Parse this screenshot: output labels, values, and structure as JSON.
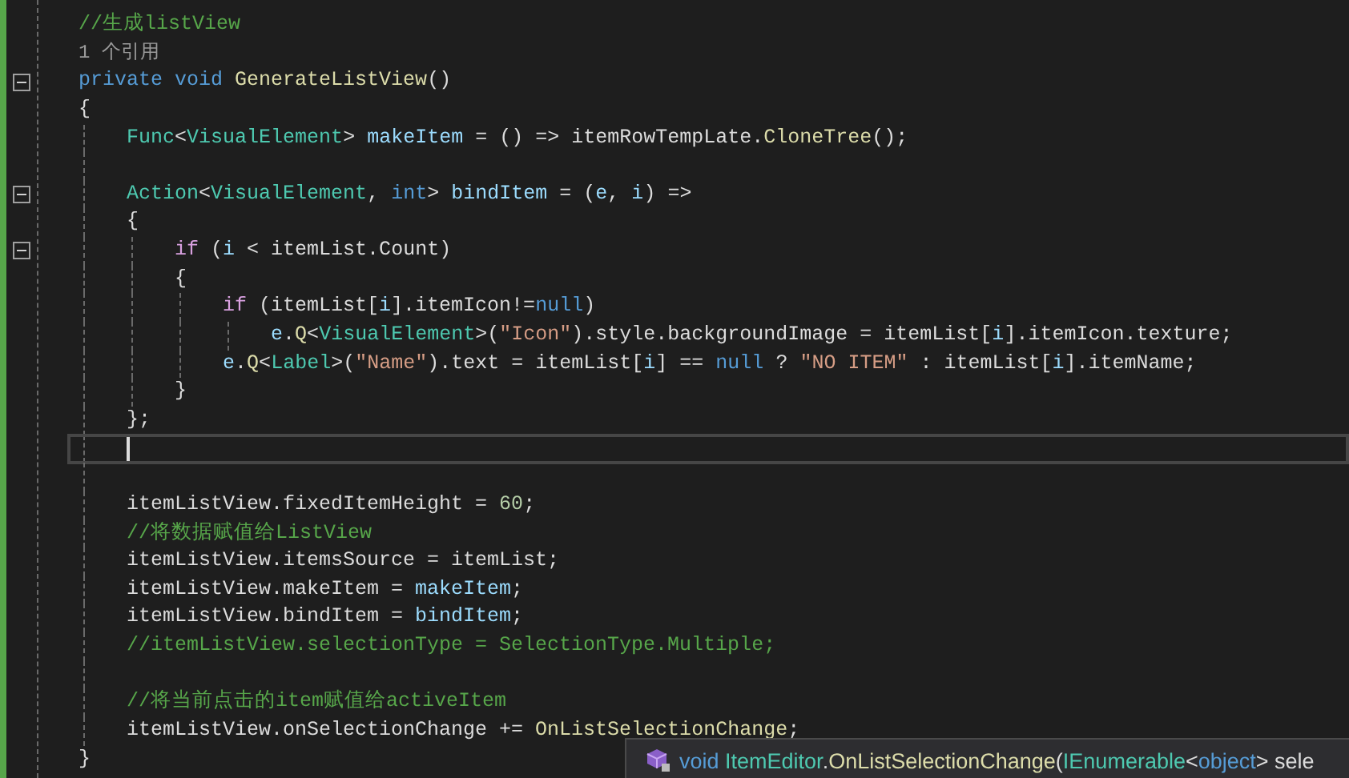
{
  "editor": {
    "lines": [
      {
        "kind": "code",
        "fold": false,
        "current": false,
        "tokens": [
          {
            "text": "//生成listView",
            "kind": "comment"
          }
        ]
      },
      {
        "kind": "codelens",
        "fold": false,
        "current": false,
        "tokens": [
          {
            "text": "1 个引用",
            "kind": "lens"
          }
        ]
      },
      {
        "kind": "code",
        "fold": true,
        "current": false,
        "tokens": [
          {
            "text": "private void ",
            "kind": "keyword"
          },
          {
            "text": "GenerateListView",
            "kind": "method"
          },
          {
            "text": "()",
            "kind": "plain"
          }
        ]
      },
      {
        "kind": "code",
        "fold": false,
        "current": false,
        "tokens": [
          {
            "text": "{",
            "kind": "plain"
          }
        ],
        "children": [
          {
            "kind": "code",
            "fold": false,
            "current": false,
            "tokens": [
              {
                "text": "Func",
                "kind": "type"
              },
              {
                "text": "<",
                "kind": "plain"
              },
              {
                "text": "VisualElement",
                "kind": "type"
              },
              {
                "text": "> ",
                "kind": "plain"
              },
              {
                "text": "makeItem",
                "kind": "local"
              },
              {
                "text": " = () => itemRowTempLate.",
                "kind": "plain"
              },
              {
                "text": "CloneTree",
                "kind": "method"
              },
              {
                "text": "();",
                "kind": "plain"
              }
            ]
          },
          {
            "kind": "blank",
            "fold": false,
            "current": false
          },
          {
            "kind": "code",
            "fold": true,
            "current": false,
            "tokens": [
              {
                "text": "Action",
                "kind": "type"
              },
              {
                "text": "<",
                "kind": "plain"
              },
              {
                "text": "VisualElement",
                "kind": "type"
              },
              {
                "text": ", ",
                "kind": "plain"
              },
              {
                "text": "int",
                "kind": "keyword"
              },
              {
                "text": "> ",
                "kind": "plain"
              },
              {
                "text": "bindItem",
                "kind": "local"
              },
              {
                "text": " = (",
                "kind": "plain"
              },
              {
                "text": "e",
                "kind": "local"
              },
              {
                "text": ", ",
                "kind": "plain"
              },
              {
                "text": "i",
                "kind": "local"
              },
              {
                "text": ") =>",
                "kind": "plain"
              }
            ]
          },
          {
            "kind": "code",
            "fold": false,
            "current": false,
            "tokens": [
              {
                "text": "{",
                "kind": "plain"
              }
            ],
            "children": [
              {
                "kind": "code",
                "fold": true,
                "current": false,
                "tokens": [
                  {
                    "text": "if",
                    "kind": "control"
                  },
                  {
                    "text": " (",
                    "kind": "plain"
                  },
                  {
                    "text": "i",
                    "kind": "local"
                  },
                  {
                    "text": " < itemList.Count)",
                    "kind": "plain"
                  }
                ]
              },
              {
                "kind": "code",
                "fold": false,
                "current": false,
                "tokens": [
                  {
                    "text": "{",
                    "kind": "plain"
                  }
                ],
                "children": [
                  {
                    "kind": "code",
                    "fold": false,
                    "current": false,
                    "tokens": [
                      {
                        "text": "if",
                        "kind": "control"
                      },
                      {
                        "text": " (itemList[",
                        "kind": "plain"
                      },
                      {
                        "text": "i",
                        "kind": "local"
                      },
                      {
                        "text": "].itemIcon!=",
                        "kind": "plain"
                      },
                      {
                        "text": "null",
                        "kind": "keyword"
                      },
                      {
                        "text": ")",
                        "kind": "plain"
                      }
                    ],
                    "children": [
                      {
                        "kind": "code",
                        "fold": false,
                        "current": false,
                        "tokens": [
                          {
                            "text": "e",
                            "kind": "local"
                          },
                          {
                            "text": ".",
                            "kind": "plain"
                          },
                          {
                            "text": "Q",
                            "kind": "method"
                          },
                          {
                            "text": "<",
                            "kind": "plain"
                          },
                          {
                            "text": "VisualElement",
                            "kind": "type"
                          },
                          {
                            "text": ">(",
                            "kind": "plain"
                          },
                          {
                            "text": "\"Icon\"",
                            "kind": "string"
                          },
                          {
                            "text": ").style.backgroundImage = itemList[",
                            "kind": "plain"
                          },
                          {
                            "text": "i",
                            "kind": "local"
                          },
                          {
                            "text": "].itemIcon.texture;",
                            "kind": "plain"
                          }
                        ]
                      }
                    ]
                  },
                  {
                    "kind": "code",
                    "fold": false,
                    "current": false,
                    "tokens": [
                      {
                        "text": "e",
                        "kind": "local"
                      },
                      {
                        "text": ".",
                        "kind": "plain"
                      },
                      {
                        "text": "Q",
                        "kind": "method"
                      },
                      {
                        "text": "<",
                        "kind": "plain"
                      },
                      {
                        "text": "Label",
                        "kind": "type"
                      },
                      {
                        "text": ">(",
                        "kind": "plain"
                      },
                      {
                        "text": "\"Name\"",
                        "kind": "string"
                      },
                      {
                        "text": ").text = itemList[",
                        "kind": "plain"
                      },
                      {
                        "text": "i",
                        "kind": "local"
                      },
                      {
                        "text": "] == ",
                        "kind": "plain"
                      },
                      {
                        "text": "null",
                        "kind": "keyword"
                      },
                      {
                        "text": " ? ",
                        "kind": "plain"
                      },
                      {
                        "text": "\"NO ITEM\"",
                        "kind": "string"
                      },
                      {
                        "text": " : itemList[",
                        "kind": "plain"
                      },
                      {
                        "text": "i",
                        "kind": "local"
                      },
                      {
                        "text": "].itemName;",
                        "kind": "plain"
                      }
                    ]
                  }
                ]
              },
              {
                "kind": "code",
                "fold": false,
                "current": false,
                "tokens": [
                  {
                    "text": "}",
                    "kind": "plain"
                  }
                ]
              }
            ]
          },
          {
            "kind": "code",
            "fold": false,
            "current": false,
            "tokens": [
              {
                "text": "};",
                "kind": "plain"
              }
            ]
          },
          {
            "kind": "blank",
            "fold": false,
            "current": true
          },
          {
            "kind": "blank",
            "fold": false,
            "current": false
          },
          {
            "kind": "code",
            "fold": false,
            "current": false,
            "tokens": [
              {
                "text": "itemListView.fixedItemHeight = ",
                "kind": "plain"
              },
              {
                "text": "60",
                "kind": "number"
              },
              {
                "text": ";",
                "kind": "plain"
              }
            ]
          },
          {
            "kind": "code",
            "fold": false,
            "current": false,
            "tokens": [
              {
                "text": "//将数据赋值给ListView",
                "kind": "comment"
              }
            ]
          },
          {
            "kind": "code",
            "fold": false,
            "current": false,
            "tokens": [
              {
                "text": "itemListView.itemsSource = itemList;",
                "kind": "plain"
              }
            ]
          },
          {
            "kind": "code",
            "fold": false,
            "current": false,
            "tokens": [
              {
                "text": "itemListView.makeItem = ",
                "kind": "plain"
              },
              {
                "text": "makeItem",
                "kind": "local"
              },
              {
                "text": ";",
                "kind": "plain"
              }
            ]
          },
          {
            "kind": "code",
            "fold": false,
            "current": false,
            "tokens": [
              {
                "text": "itemListView.bindItem = ",
                "kind": "plain"
              },
              {
                "text": "bindItem",
                "kind": "local"
              },
              {
                "text": ";",
                "kind": "plain"
              }
            ]
          },
          {
            "kind": "code",
            "fold": false,
            "current": false,
            "tokens": [
              {
                "text": "//itemListView.selectionType = SelectionType.Multiple;",
                "kind": "comment"
              }
            ]
          },
          {
            "kind": "blank",
            "fold": false,
            "current": false
          },
          {
            "kind": "code",
            "fold": false,
            "current": false,
            "tokens": [
              {
                "text": "//将当前点击的item赋值给activeItem",
                "kind": "comment"
              }
            ]
          },
          {
            "kind": "code",
            "fold": false,
            "current": false,
            "tokens": [
              {
                "text": "itemListView.onSelectionChange += ",
                "kind": "plain"
              },
              {
                "text": "OnListSelectionChange",
                "kind": "method"
              },
              {
                "text": ";",
                "kind": "plain"
              }
            ]
          }
        ]
      },
      {
        "kind": "code",
        "fold": false,
        "current": false,
        "tokens": [
          {
            "text": "}",
            "kind": "plain"
          }
        ]
      }
    ]
  },
  "tooltip": {
    "tokens": [
      {
        "text": "void ",
        "kind": "keyword"
      },
      {
        "text": "ItemEditor",
        "kind": "type"
      },
      {
        "text": ".",
        "kind": "plain"
      },
      {
        "text": "OnListSelectionChange",
        "kind": "method"
      },
      {
        "text": "(",
        "kind": "plain"
      },
      {
        "text": "IEnumerable",
        "kind": "type"
      },
      {
        "text": "<",
        "kind": "plain"
      },
      {
        "text": "object",
        "kind": "keyword"
      },
      {
        "text": "> sele",
        "kind": "plain"
      }
    ]
  }
}
